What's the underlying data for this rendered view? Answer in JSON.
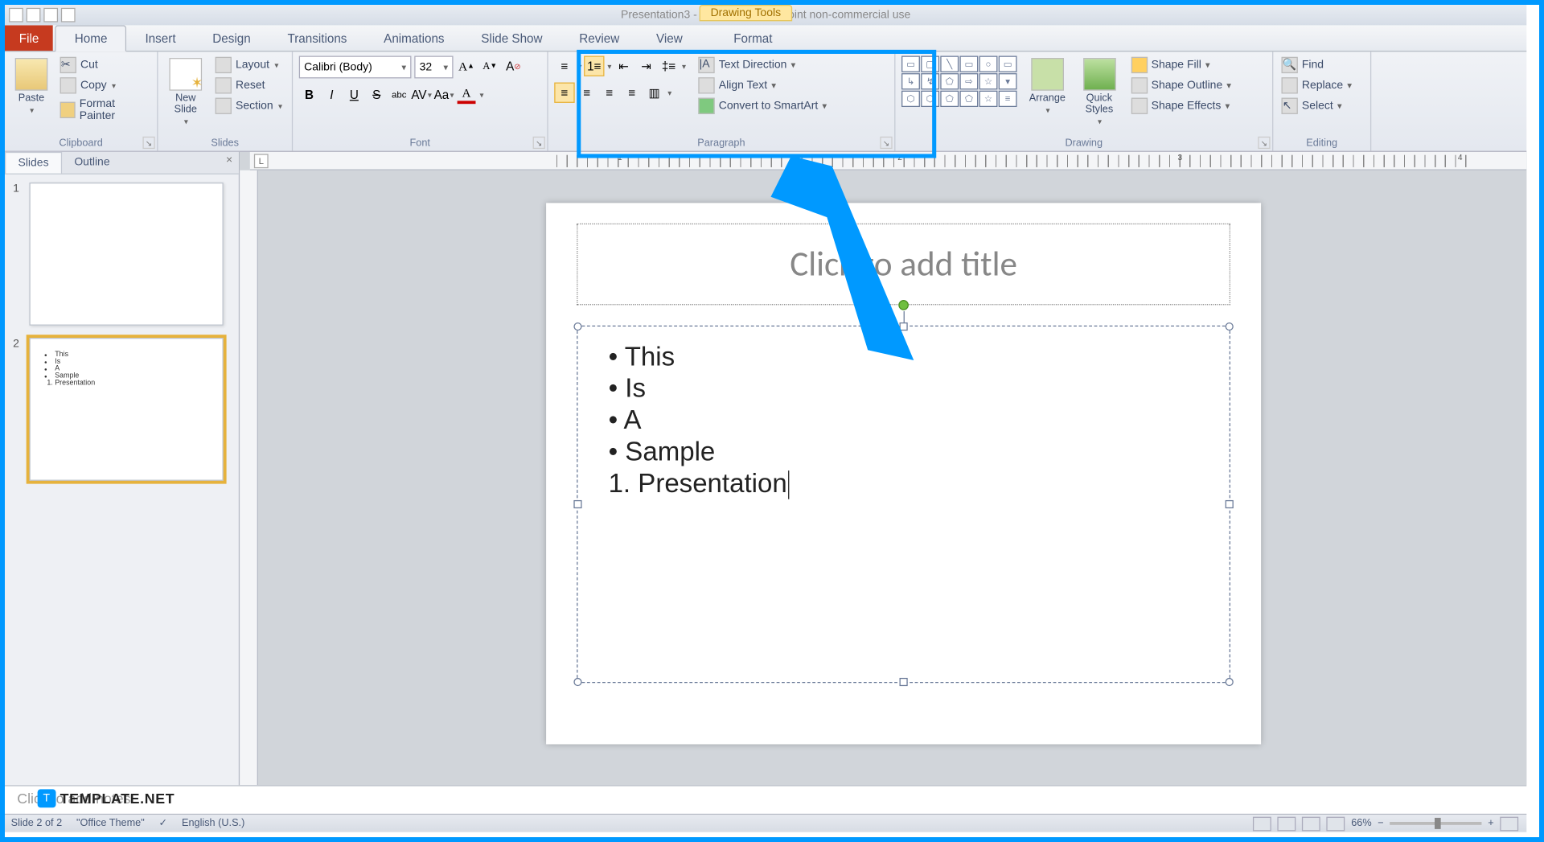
{
  "app": {
    "title": "Presentation3 - Microsoft PowerPoint non-commercial use",
    "context_tab": "Drawing Tools"
  },
  "tabs": {
    "file": "File",
    "home": "Home",
    "insert": "Insert",
    "design": "Design",
    "transitions": "Transitions",
    "animations": "Animations",
    "slideshow": "Slide Show",
    "review": "Review",
    "view": "View",
    "format": "Format"
  },
  "ribbon": {
    "clipboard": {
      "label": "Clipboard",
      "paste": "Paste",
      "cut": "Cut",
      "copy": "Copy",
      "format_painter": "Format Painter"
    },
    "slides": {
      "label": "Slides",
      "new_slide": "New Slide",
      "layout": "Layout",
      "reset": "Reset",
      "section": "Section"
    },
    "font": {
      "label": "Font",
      "name": "Calibri (Body)",
      "size": "32"
    },
    "paragraph": {
      "label": "Paragraph",
      "text_direction": "Text Direction",
      "align_text": "Align Text",
      "convert_smart": "Convert to SmartArt"
    },
    "drawing": {
      "label": "Drawing",
      "arrange": "Arrange",
      "quick_styles": "Quick Styles",
      "shape_fill": "Shape Fill",
      "shape_outline": "Shape Outline",
      "shape_effects": "Shape Effects"
    },
    "editing": {
      "label": "Editing",
      "find": "Find",
      "replace": "Replace",
      "select": "Select"
    }
  },
  "sidepane": {
    "slides_tab": "Slides",
    "outline_tab": "Outline"
  },
  "slide": {
    "title_placeholder": "Click to add title",
    "bullets": [
      "This",
      "Is",
      "A",
      "Sample"
    ],
    "numbered": [
      "Presentation"
    ]
  },
  "thumb2": {
    "bullets": [
      "This",
      "Is",
      "A",
      "Sample"
    ],
    "numbered": [
      "Presentation"
    ]
  },
  "notes": {
    "placeholder": "Click to add notes"
  },
  "status": {
    "slide_info": "Slide 2 of 2",
    "theme": "\"Office Theme\"",
    "lang": "English (U.S.)",
    "zoom": "66%"
  },
  "watermark": {
    "text": "TEMPLATE.NET"
  }
}
